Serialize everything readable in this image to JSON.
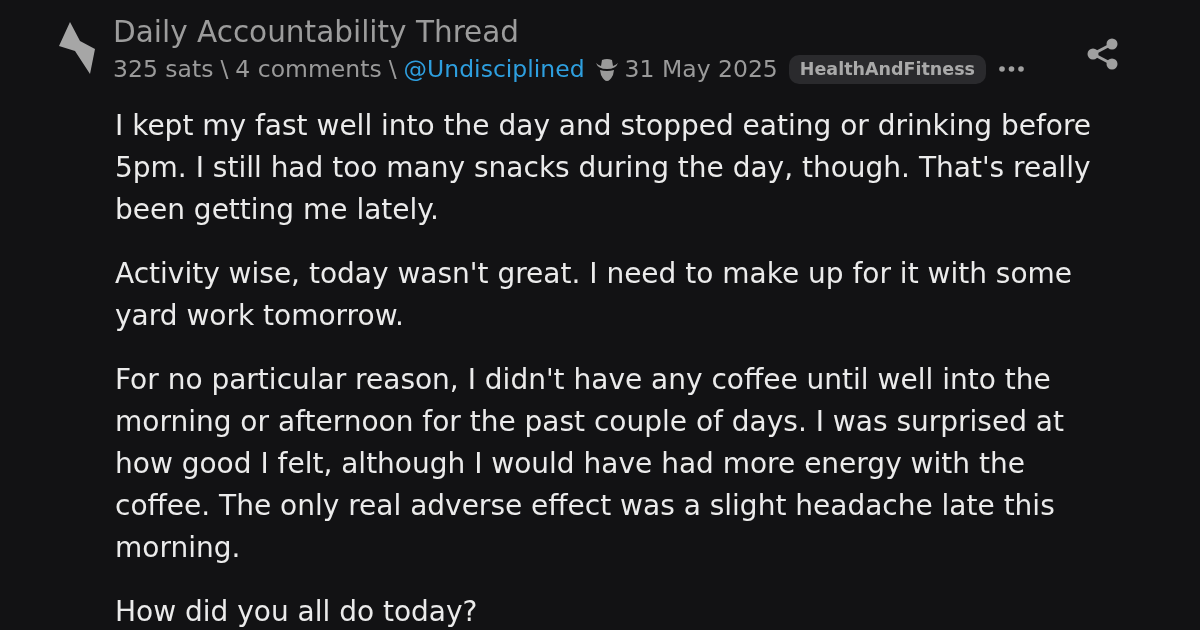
{
  "post": {
    "title": "Daily Accountability Thread",
    "meta": {
      "sats": "325 sats",
      "separator_1": "\\",
      "comments": "4 comments",
      "separator_2": "\\",
      "author": "@Undisciplined",
      "date": "31 May 2025",
      "tag": "HealthAndFitness"
    }
  },
  "body": [
    "I kept my fast well into the day and stopped eating or drinking before 5pm. I still had too many snacks during the day, though. That's really been getting me lately.",
    "Activity wise, today wasn't great. I need to make up for it with some yard work tomorrow.",
    "For no particular reason, I didn't have any coffee until well into the morning or afternoon for the past couple of days. I was surprised at how good I felt, although I would have had more energy with the coffee. The only real adverse effect was a slight headache late this morning.",
    "How did you all do today?"
  ]
}
